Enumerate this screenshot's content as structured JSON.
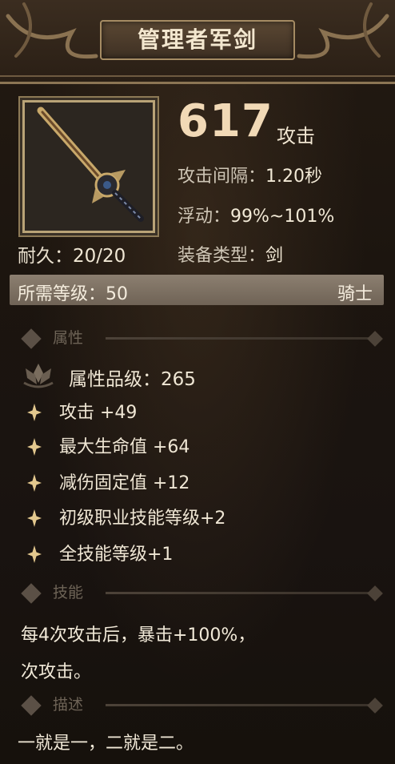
{
  "item": {
    "name": "管理者军剑",
    "durability_label": "耐久：",
    "durability_value": "20/20"
  },
  "stats": {
    "attack_value": "617",
    "attack_label": "攻击",
    "interval_label": "攻击间隔：",
    "interval_value": "1.20秒",
    "float_label": "浮动：",
    "float_value": "99%~101%",
    "type_label": "装备类型：",
    "type_value": "剑"
  },
  "requirement": {
    "level_label": "所需等级：",
    "level_value": "50",
    "class_name": "骑士"
  },
  "sections": {
    "attributes": "属性",
    "skills": "技能",
    "description": "描述"
  },
  "attributes": {
    "grade_label": "属性品级：",
    "grade_value": "265",
    "items": [
      "攻击 +49",
      "最大生命值 +64",
      "减伤固定值 +12",
      "初级职业技能等级+2",
      "全技能等级+1"
    ]
  },
  "skill": {
    "lines": [
      "每4次攻击后，暴击+100%，",
      "次攻击。"
    ]
  },
  "description": {
    "text": "一就是一，二就是二。"
  },
  "colors": {
    "accent_gold": "#b9a377",
    "attack_number": "#f1d9b6",
    "level_bar": "#8c7f70"
  },
  "icons": {
    "weapon": "sword-icon",
    "grade": "lotus-icon",
    "bullet": "sparkle-icon"
  }
}
